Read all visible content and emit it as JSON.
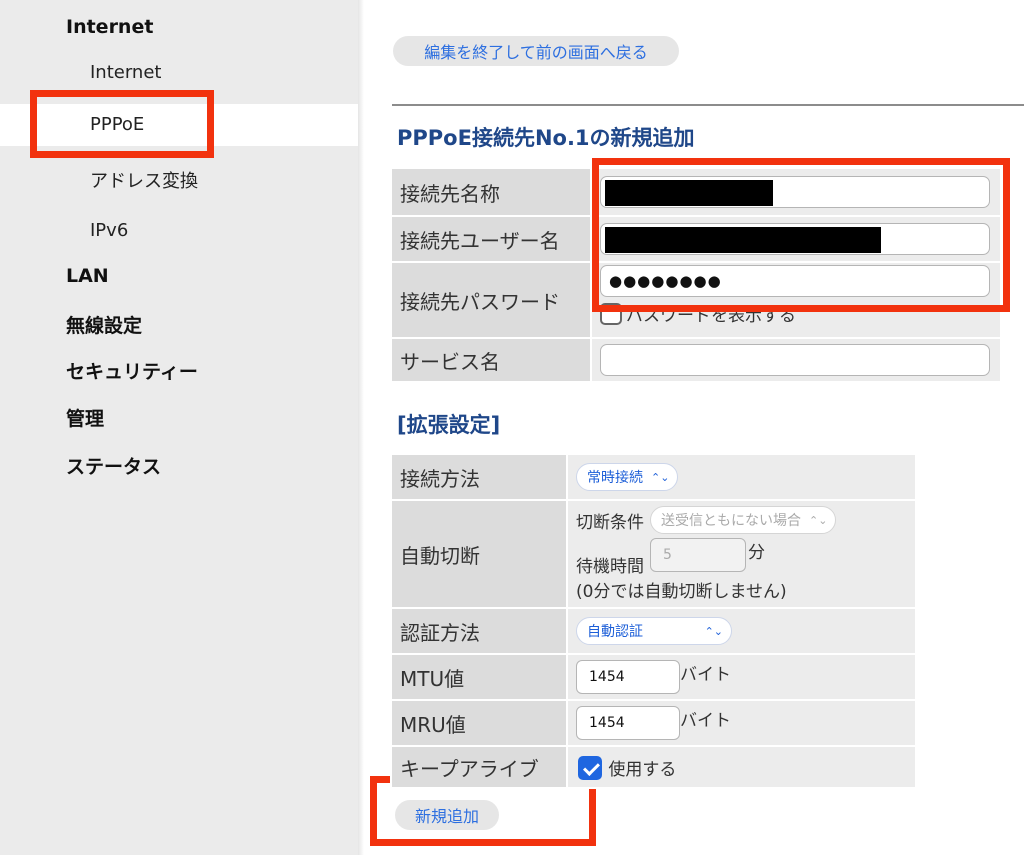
{
  "sidebar": {
    "sections": [
      {
        "label": "Internet"
      },
      {
        "label": "LAN"
      },
      {
        "label": "無線設定"
      },
      {
        "label": "セキュリティー"
      },
      {
        "label": "管理"
      },
      {
        "label": "ステータス"
      }
    ],
    "internet_items": [
      {
        "label": "Internet"
      },
      {
        "label": "PPPoE"
      },
      {
        "label": "アドレス変換"
      },
      {
        "label": "IPv6"
      }
    ]
  },
  "main": {
    "back_button": "編集を終了して前の画面へ戻る",
    "title": "PPPoE接続先No.1の新規追加",
    "basic": {
      "name_label": "接続先名称",
      "user_label": "接続先ユーザー名",
      "password_label": "接続先パスワード",
      "password_value": "●●●●●●●●",
      "show_password": "パスワードを表示する",
      "service_label": "サービス名",
      "service_value": ""
    },
    "extended_title": "[拡張設定]",
    "extended": {
      "connect_method_label": "接続方法",
      "connect_method_value": "常時接続",
      "auto_disconnect_label": "自動切断",
      "cut_condition_label": "切断条件",
      "cut_condition_value": "送受信ともにない場合",
      "wait_time_label": "待機時間",
      "wait_time_value": "5",
      "wait_time_unit": "分",
      "wait_time_note": "(0分では自動切断しません)",
      "auth_label": "認証方法",
      "auth_value": "自動認証",
      "mtu_label": "MTU値",
      "mtu_value": "1454",
      "mtu_unit": "バイト",
      "mru_label": "MRU値",
      "mru_value": "1454",
      "mru_unit": "バイト",
      "keepalive_label": "キープアライブ",
      "keepalive_use": "使用する",
      "keepalive_checked": true
    },
    "add_button": "新規追加"
  },
  "colors": {
    "highlight": "#f2320e",
    "title_blue": "#1f4789",
    "link_blue": "#2d6fe0"
  }
}
